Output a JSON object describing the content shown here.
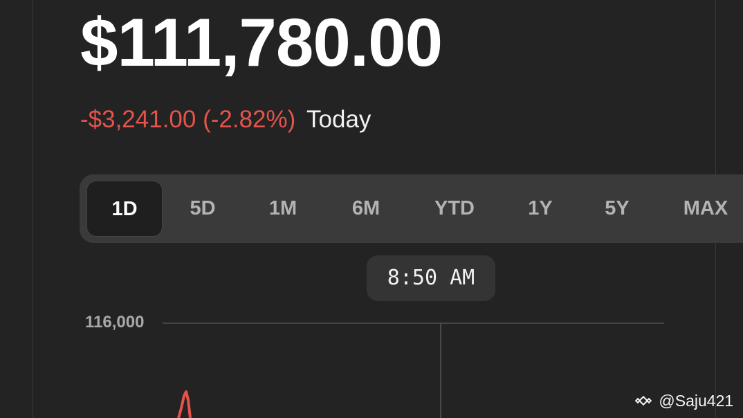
{
  "price": "$111,780.00",
  "change": {
    "amount_text": "-$3,241.00 (-2.82%)",
    "period": "Today",
    "color": "#e5534b"
  },
  "ranges": [
    {
      "label": "1D",
      "active": true
    },
    {
      "label": "5D",
      "active": false
    },
    {
      "label": "1M",
      "active": false
    },
    {
      "label": "6M",
      "active": false
    },
    {
      "label": "YTD",
      "active": false
    },
    {
      "label": "1Y",
      "active": false
    },
    {
      "label": "5Y",
      "active": false
    },
    {
      "label": "MAX",
      "active": false
    }
  ],
  "chart": {
    "time_label": "8:50 AM",
    "y_tick": "116,000",
    "line_color": "#e5534b"
  },
  "watermark": {
    "icon": "binance-logo-icon",
    "text": "@Saju421"
  }
}
